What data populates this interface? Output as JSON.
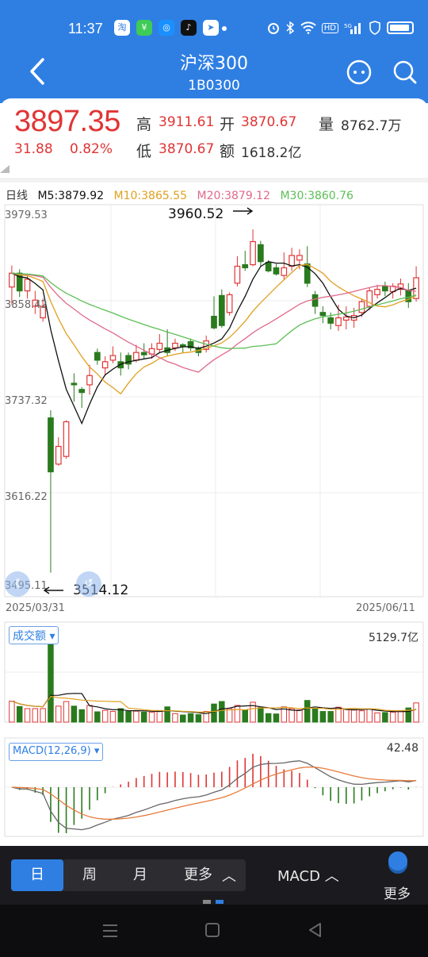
{
  "status": {
    "time": "11:37",
    "apps": [
      "淘",
      "¥",
      "◎",
      "♪",
      "➤"
    ]
  },
  "header": {
    "title": "沪深300",
    "code": "1B0300"
  },
  "quote": {
    "price": "3897.35",
    "change": "31.88",
    "change_pct": "0.82%",
    "high_label": "高",
    "high": "3911.61",
    "open_label": "开",
    "open": "3870.67",
    "volume_label": "量",
    "volume": "8762.7万",
    "low_label": "低",
    "low": "3870.67",
    "amount_label": "额",
    "amount": "1618.2亿"
  },
  "chart": {
    "period_label": "日线",
    "ma5": "M5:3879.92",
    "ma10": "M10:3865.55",
    "ma20": "M20:3879.12",
    "ma30": "M30:3860.76",
    "y_labels": [
      "3979.53",
      "3858.42",
      "3737.32",
      "3616.22",
      "3495.11"
    ],
    "max_annotation": "3960.52",
    "min_annotation": "3514.12",
    "date_start": "2025/03/31",
    "date_end": "2025/06/11",
    "colors": {
      "up": "#e03535",
      "down": "#2a7a1e",
      "ma5": "#111111",
      "ma10": "#e0a020",
      "ma20": "#e06a8a",
      "ma30": "#5cbf55"
    }
  },
  "volume": {
    "legend": "成交额",
    "max_value": "5129.7亿"
  },
  "macd": {
    "legend": "MACD(12,26,9)",
    "max_value": "42.48"
  },
  "toolbar": {
    "tabs": [
      "日",
      "周",
      "月",
      "更多"
    ],
    "indicator": "MACD",
    "more": "更多"
  },
  "chart_data": {
    "type": "candlestick",
    "title": "沪深300",
    "x_range": [
      "2025/03/31",
      "2025/06/11"
    ],
    "ylim": [
      3495.11,
      3979.53
    ],
    "ma_values": {
      "M5": 3879.92,
      "M10": 3865.55,
      "M20": 3879.12,
      "M30": 3860.76
    },
    "annotations": [
      {
        "label": "max",
        "value": 3960.52
      },
      {
        "label": "min",
        "value": 3514.12
      }
    ],
    "candles": [
      [
        3885,
        3903,
        3913,
        3862
      ],
      [
        3903,
        3880,
        3908,
        3872
      ],
      [
        3880,
        3895,
        3900,
        3870
      ],
      [
        3860,
        3868,
        3880,
        3850
      ],
      [
        3845,
        3860,
        3870,
        3840
      ],
      [
        3715,
        3645,
        3725,
        3514
      ],
      [
        3655,
        3678,
        3690,
        3653
      ],
      [
        3665,
        3710,
        3712,
        3662
      ],
      [
        3760,
        3758,
        3773,
        3736
      ],
      [
        3752,
        3748,
        3755,
        3728
      ],
      [
        3758,
        3770,
        3784,
        3745
      ],
      [
        3800,
        3790,
        3805,
        3784
      ],
      [
        3780,
        3788,
        3795,
        3770
      ],
      [
        3790,
        3796,
        3808,
        3786
      ],
      [
        3788,
        3780,
        3800,
        3770
      ],
      [
        3796,
        3785,
        3800,
        3778
      ],
      [
        3790,
        3800,
        3810,
        3787
      ],
      [
        3800,
        3797,
        3812,
        3792
      ],
      [
        3798,
        3805,
        3812,
        3792
      ],
      [
        3804,
        3812,
        3824,
        3800
      ],
      [
        3806,
        3800,
        3830,
        3795
      ],
      [
        3806,
        3812,
        3818,
        3802
      ],
      [
        3810,
        3808,
        3812,
        3800
      ],
      [
        3814,
        3806,
        3818,
        3802
      ],
      [
        3806,
        3800,
        3808,
        3795
      ],
      [
        3804,
        3815,
        3822,
        3800
      ],
      [
        3847,
        3832,
        3873,
        3830
      ],
      [
        3874,
        3835,
        3882,
        3832
      ],
      [
        3852,
        3875,
        3878,
        3848
      ],
      [
        3890,
        3912,
        3925,
        3886
      ],
      [
        3914,
        3910,
        3932,
        3906
      ],
      [
        3914,
        3944,
        3960,
        3912
      ],
      [
        3940,
        3918,
        3945,
        3912
      ],
      [
        3917,
        3906,
        3920,
        3904
      ],
      [
        3910,
        3902,
        3915,
        3900
      ],
      [
        3900,
        3910,
        3930,
        3895
      ],
      [
        3912,
        3926,
        3936,
        3906
      ],
      [
        3920,
        3926,
        3934,
        3908
      ],
      [
        3915,
        3890,
        3938,
        3885
      ],
      [
        3875,
        3860,
        3880,
        3850
      ],
      [
        3852,
        3848,
        3860,
        3838
      ],
      [
        3845,
        3838,
        3852,
        3830
      ],
      [
        3835,
        3845,
        3862,
        3828
      ],
      [
        3842,
        3846,
        3860,
        3830
      ],
      [
        3842,
        3848,
        3858,
        3832
      ],
      [
        3852,
        3866,
        3870,
        3846
      ],
      [
        3860,
        3880,
        3884,
        3855
      ],
      [
        3875,
        3882,
        3888,
        3870
      ],
      [
        3886,
        3880,
        3892,
        3873
      ],
      [
        3879,
        3886,
        3890,
        3870
      ],
      [
        3882,
        3889,
        3896,
        3874
      ],
      [
        3880,
        3866,
        3890,
        3858
      ],
      [
        3870,
        3897,
        3912,
        3866
      ]
    ]
  }
}
